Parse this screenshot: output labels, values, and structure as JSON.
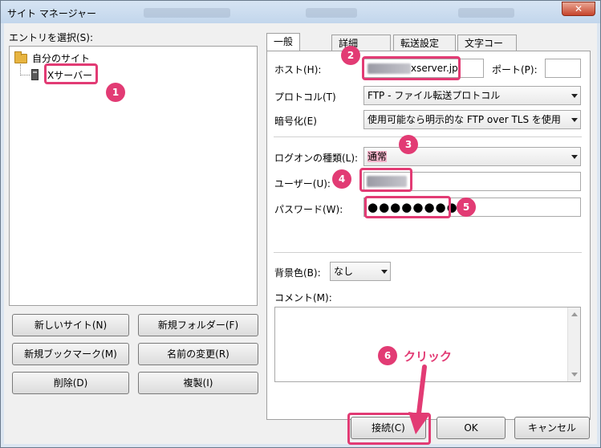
{
  "window": {
    "title": "サイト マネージャー",
    "close": "✕"
  },
  "left": {
    "entry_label": "エントリを選択(S):",
    "tree": {
      "root": "自分のサイト",
      "child": "Xサーバー"
    },
    "buttons": {
      "new_site": "新しいサイト(N)",
      "new_folder": "新規フォルダー(F)",
      "new_bookmark": "新規ブックマーク(M)",
      "rename": "名前の変更(R)",
      "delete": "削除(D)",
      "duplicate": "複製(I)"
    }
  },
  "tabs": [
    "一般",
    "詳細",
    "転送設定",
    "文字コード"
  ],
  "general": {
    "host_label": "ホスト(H):",
    "host_value": "xserver.jp",
    "port_label": "ポート(P):",
    "port_value": "",
    "protocol_label": "プロトコル(T)",
    "protocol_value": "FTP - ファイル転送プロトコル",
    "encryption_label": "暗号化(E)",
    "encryption_value": "使用可能なら明示的な FTP over TLS を使用",
    "logon_label": "ログオンの種類(L):",
    "logon_value": "通常",
    "user_label": "ユーザー(U):",
    "password_label": "パスワード(W):",
    "password_value": "●●●●●●●●",
    "bgcolor_label": "背景色(B):",
    "bgcolor_value": "なし",
    "comment_label": "コメント(M):"
  },
  "bottom_buttons": {
    "connect": "接続(C)",
    "ok": "OK",
    "cancel": "キャンセル"
  },
  "annotations": {
    "steps": [
      "1",
      "2",
      "3",
      "4",
      "5",
      "6"
    ],
    "click_text": "クリック",
    "color": "#e23b74"
  }
}
